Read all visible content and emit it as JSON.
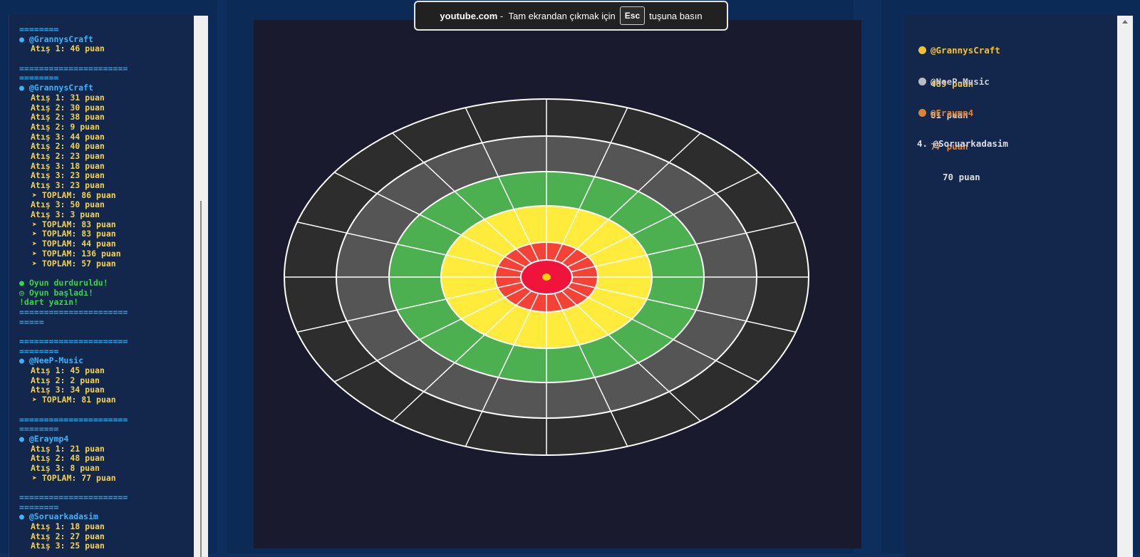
{
  "toast": {
    "site": "youtube.com",
    "before_key": "Tam ekrandan çıkmak için",
    "key": "Esc",
    "after_key": "tuşuna basın"
  },
  "log": [
    {
      "t": "sep",
      "text": "========"
    },
    {
      "t": "user",
      "text": "@GrannysCraft"
    },
    {
      "t": "shot",
      "text": "Atış 1: 46 puan"
    },
    {
      "t": "gap",
      "text": ""
    },
    {
      "t": "sep",
      "text": "======================"
    },
    {
      "t": "sep",
      "text": "========"
    },
    {
      "t": "user",
      "text": "@GrannysCraft"
    },
    {
      "t": "shot",
      "text": "Atış 1: 31 puan"
    },
    {
      "t": "shot",
      "text": "Atış 2: 30 puan"
    },
    {
      "t": "shot",
      "text": "Atış 2: 38 puan"
    },
    {
      "t": "shot",
      "text": "Atış 2: 9 puan"
    },
    {
      "t": "shot",
      "text": "Atış 3: 44 puan"
    },
    {
      "t": "shot",
      "text": "Atış 2: 40 puan"
    },
    {
      "t": "shot",
      "text": "Atış 2: 23 puan"
    },
    {
      "t": "shot",
      "text": "Atış 3: 18 puan"
    },
    {
      "t": "shot",
      "text": "Atış 3: 23 puan"
    },
    {
      "t": "shot",
      "text": "Atış 3: 23 puan"
    },
    {
      "t": "total",
      "text": "TOPLAM: 86 puan"
    },
    {
      "t": "shot",
      "text": "Atış 3: 50 puan"
    },
    {
      "t": "shot",
      "text": "Atış 3: 3 puan"
    },
    {
      "t": "total",
      "text": "TOPLAM: 83 puan"
    },
    {
      "t": "total",
      "text": "TOPLAM: 83 puan"
    },
    {
      "t": "total",
      "text": "TOPLAM: 44 puan"
    },
    {
      "t": "total",
      "text": "TOPLAM: 136 puan"
    },
    {
      "t": "total",
      "text": "TOPLAM: 57 puan"
    },
    {
      "t": "gap",
      "text": ""
    },
    {
      "t": "green",
      "text": "Oyun durduruldu!"
    },
    {
      "t": "green",
      "text": "Oyun başladı!"
    },
    {
      "t": "green",
      "text": "!dart yazın!"
    },
    {
      "t": "sep",
      "text": "======================"
    },
    {
      "t": "sep",
      "text": "====="
    },
    {
      "t": "gap",
      "text": ""
    },
    {
      "t": "sep",
      "text": "======================"
    },
    {
      "t": "sep",
      "text": "========"
    },
    {
      "t": "user",
      "text": "@NeeP-Music"
    },
    {
      "t": "shot",
      "text": "Atış 1: 45 puan"
    },
    {
      "t": "shot",
      "text": "Atış 2: 2 puan"
    },
    {
      "t": "shot",
      "text": "Atış 3: 34 puan"
    },
    {
      "t": "total",
      "text": "TOPLAM: 81 puan"
    },
    {
      "t": "gap",
      "text": ""
    },
    {
      "t": "sep",
      "text": "======================"
    },
    {
      "t": "sep",
      "text": "========"
    },
    {
      "t": "user",
      "text": "@Eraymp4"
    },
    {
      "t": "shot",
      "text": "Atış 1: 21 puan"
    },
    {
      "t": "shot",
      "text": "Atış 2: 48 puan"
    },
    {
      "t": "shot",
      "text": "Atış 3: 8 puan"
    },
    {
      "t": "total",
      "text": "TOPLAM: 77 puan"
    },
    {
      "t": "gap",
      "text": ""
    },
    {
      "t": "sep",
      "text": "======================"
    },
    {
      "t": "sep",
      "text": "========"
    },
    {
      "t": "user",
      "text": "@Soruarkadasim"
    },
    {
      "t": "shot",
      "text": "Atış 1: 18 puan"
    },
    {
      "t": "shot",
      "text": "Atış 2: 27 puan"
    },
    {
      "t": "shot",
      "text": "Atış 3: 25 puan"
    }
  ],
  "leaderboard": [
    {
      "rank": "",
      "name": "@GrannysCraft",
      "points": "489 puan",
      "medal": "gold",
      "color": "#f4c22a"
    },
    {
      "rank": "",
      "name": "@NeeP-Music",
      "points": "81 puan",
      "medal": "silver",
      "color": "#c9ccd3"
    },
    {
      "rank": "",
      "name": "@Eraymp4",
      "points": "77 puan",
      "medal": "bronze",
      "color": "#e0822d"
    },
    {
      "rank": "4.",
      "name": "@Soruarkadasim",
      "points": "70 puan",
      "medal": "none",
      "color": "#d9dde5"
    }
  ],
  "dartboard": {
    "segments": 20,
    "rings": [
      {
        "name": "outer",
        "color": "#2d2d2d"
      },
      {
        "name": "grey",
        "color": "#555555"
      },
      {
        "name": "green",
        "color": "#4caf50"
      },
      {
        "name": "yellow",
        "color": "#ffeb3b"
      },
      {
        "name": "red-outer",
        "color": "#f44336"
      },
      {
        "name": "red-inner",
        "color": "#f0143c"
      }
    ],
    "bullseye_color": "#ffd400",
    "line_color": "#ffffff",
    "background": "#1a1a2f"
  }
}
